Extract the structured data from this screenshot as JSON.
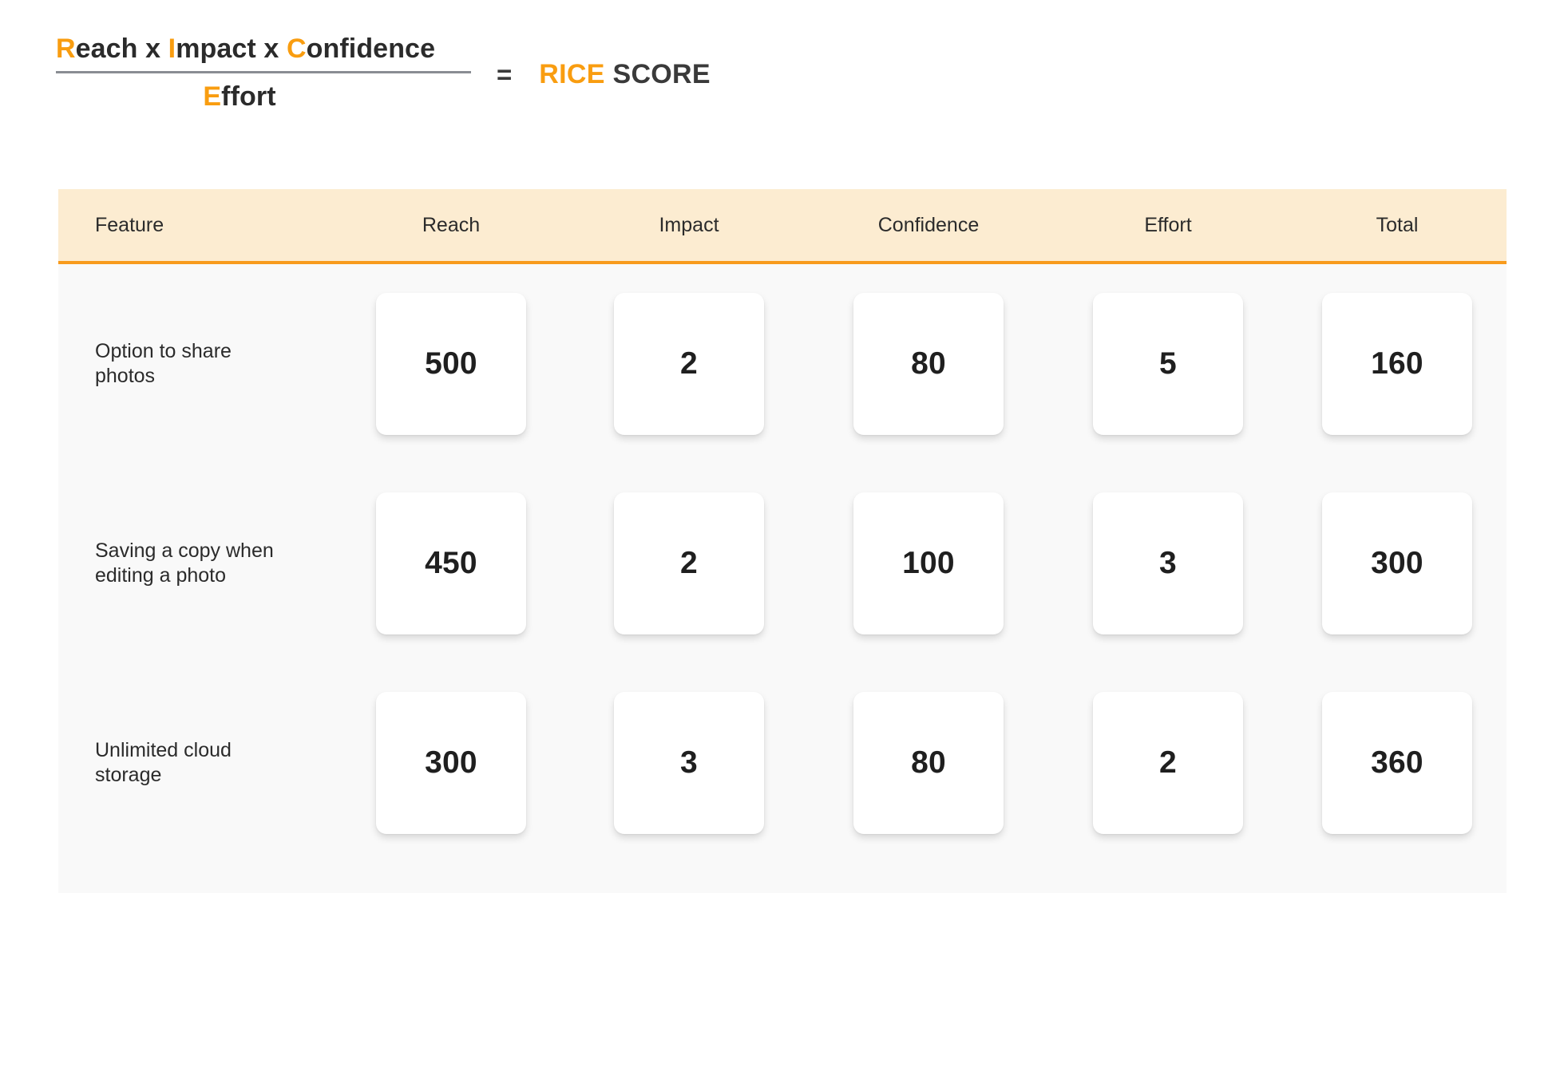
{
  "formula": {
    "numerator_parts": [
      {
        "text": "R",
        "accent": true
      },
      {
        "text": "each x ",
        "accent": false
      },
      {
        "text": "I",
        "accent": true
      },
      {
        "text": "mpact x ",
        "accent": false
      },
      {
        "text": "C",
        "accent": true
      },
      {
        "text": "onfidence",
        "accent": false
      }
    ],
    "numerator_plain": "Reach x Impact x Confidence",
    "denominator_accent": "E",
    "denominator_rest": "ffort",
    "denominator_plain": "Effort",
    "equals": "=",
    "result_accent": "RICE",
    "result_rest": "SCORE"
  },
  "colors": {
    "accent_orange": "#f99d10",
    "header_band": "#fcecd1",
    "header_border": "#f89b1c",
    "body_bg": "#f9f9f9",
    "card_bg": "#ffffff",
    "text_dark": "#2b2b2b",
    "rule_gray": "#8a8d93"
  },
  "table": {
    "headers": {
      "feature": "Feature",
      "reach": "Reach",
      "impact": "Impact",
      "confidence": "Confidence",
      "effort": "Effort",
      "total": "Total"
    },
    "rows": [
      {
        "feature": "Option to share photos",
        "reach": "500",
        "impact": "2",
        "confidence": "80",
        "effort": "5",
        "total": "160"
      },
      {
        "feature": "Saving a copy when editing a photo",
        "reach": "450",
        "impact": "2",
        "confidence": "100",
        "effort": "3",
        "total": "300"
      },
      {
        "feature": "Unlimited cloud storage",
        "reach": "300",
        "impact": "3",
        "confidence": "80",
        "effort": "2",
        "total": "360"
      }
    ]
  }
}
